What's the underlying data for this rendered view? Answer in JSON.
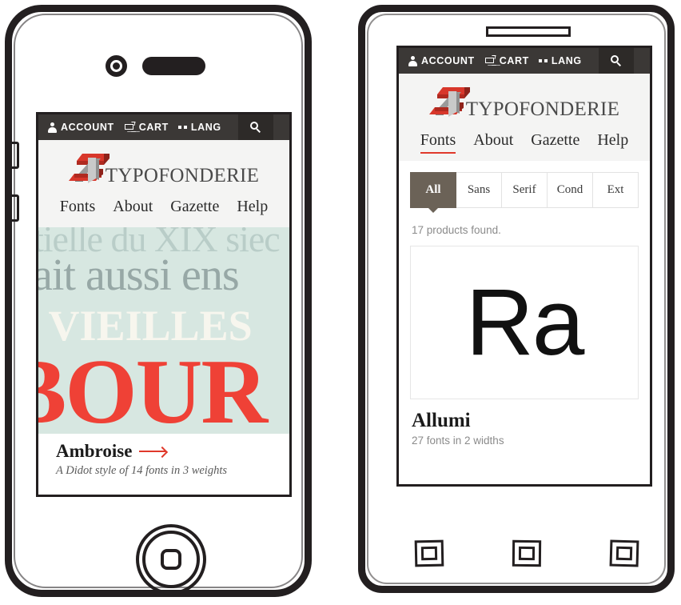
{
  "topbar": {
    "account_label": "ACCOUNT",
    "cart_label": "CART",
    "lang_label": "LANG",
    "account_icon": "person-icon",
    "cart_icon": "cart-icon",
    "lang_icon": "lang-dots-icon",
    "search_icon": "search-icon",
    "bg_color": "#3b3836",
    "search_bg_color": "#2d2a28"
  },
  "brand": {
    "wordmark": "TYPOFONDERIE",
    "logo_icon": "typofonderie-z-logo",
    "logo_red": "#d8372b",
    "logo_gray": "#9a9a9a"
  },
  "nav": {
    "items": [
      {
        "label": "Fonts"
      },
      {
        "label": "About"
      },
      {
        "label": "Gazette"
      },
      {
        "label": "Help"
      }
    ],
    "active_index_left": -1,
    "active_index_right": 0,
    "active_underline_color": "#e0392b"
  },
  "left_phone": {
    "specimen": {
      "line1": "ntielle du XIX siec",
      "line2": "vait aussi ens",
      "line3": "S VIEILLES ",
      "line4": "BOUR",
      "bg_color": "#d7e7e1",
      "line1_color": "#b9cdc8",
      "line2_color": "#97a8a6",
      "line3_color": "#f7f6ee",
      "line4_color": "#ef4136"
    },
    "product": {
      "name": "Ambroise",
      "arrow_icon": "arrow-right-icon",
      "description": "A Didot style of 14 fonts in 3 weights"
    },
    "hardware": {
      "camera_icon": "front-camera-icon",
      "speaker_icon": "earpiece-speaker-icon",
      "home_icon": "home-button-icon",
      "volume_up_icon": "volume-up-button",
      "volume_down_icon": "volume-down-button"
    }
  },
  "right_phone": {
    "filters": [
      {
        "label": "All",
        "active": true
      },
      {
        "label": "Sans",
        "active": false
      },
      {
        "label": "Serif",
        "active": false
      },
      {
        "label": "Cond",
        "active": false
      },
      {
        "label": "Ext",
        "active": false
      }
    ],
    "filter_active_color": "#6b6257",
    "results_text": "17 products found.",
    "product": {
      "specimen_glyph": "Ra",
      "name": "Allumi",
      "subtitle": "27 fonts in 2 widths"
    },
    "hardware": {
      "speaker_icon": "earpiece-speaker-icon",
      "nav_button_1_icon": "square-nav-button",
      "nav_button_2_icon": "square-nav-button",
      "nav_button_3_icon": "square-nav-button"
    }
  }
}
